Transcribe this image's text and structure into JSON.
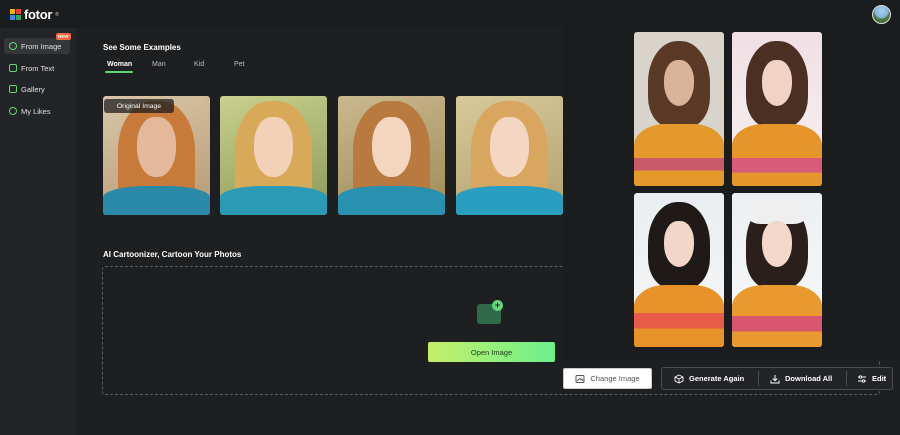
{
  "app": {
    "brand": "fotor",
    "brand_mark": "®",
    "colors": {
      "accent": "#5fd67a",
      "badge": "#f26a3d"
    }
  },
  "header": {
    "avatar_icon": "user-avatar"
  },
  "sidebar": {
    "items": [
      {
        "label": "From Image",
        "icon": "image-icon",
        "active": true,
        "badge": "NEW"
      },
      {
        "label": "From Text",
        "icon": "text-icon"
      },
      {
        "label": "Gallery",
        "icon": "gallery-icon"
      },
      {
        "label": "My Likes",
        "icon": "heart-icon"
      }
    ]
  },
  "examples": {
    "title": "See Some Examples",
    "tabs": [
      "Woman",
      "Man",
      "Kid",
      "Pet"
    ],
    "active_tab": "Woman",
    "original_label": "Original Image"
  },
  "upload": {
    "title": "AI Cartoonizer, Cartoon Your Photos",
    "button": "Open Image"
  },
  "actions": {
    "change": "Change Image",
    "generate": "Generate Again",
    "download": "Download All",
    "edit": "Edit"
  }
}
